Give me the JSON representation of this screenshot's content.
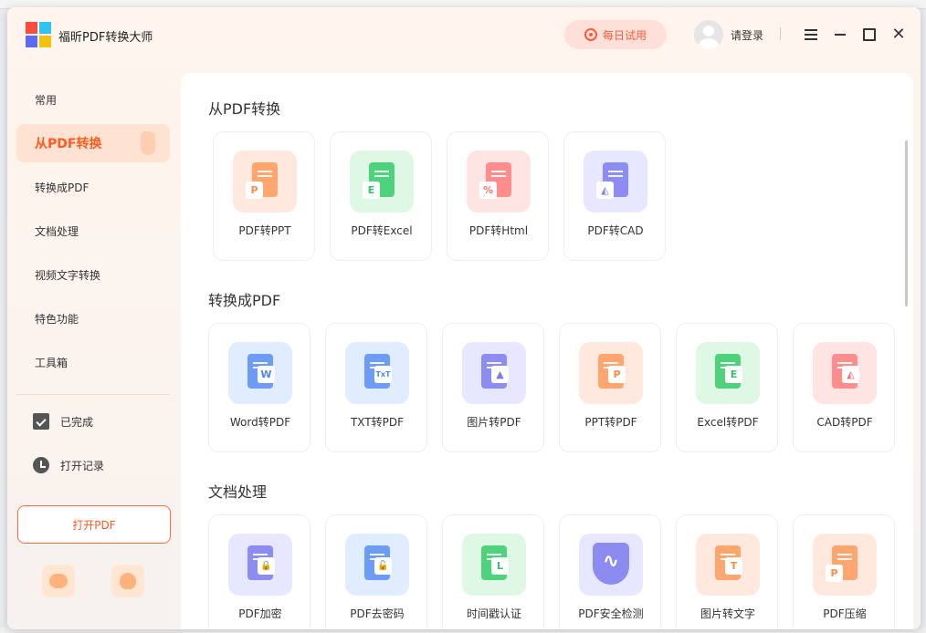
{
  "app": {
    "title": "福昕PDF转换大师",
    "trial_label": "每日试用",
    "login_label": "请登录"
  },
  "sidebar": {
    "items": [
      {
        "label": "常用"
      },
      {
        "label": "从PDF转换",
        "active": true
      },
      {
        "label": "转换成PDF"
      },
      {
        "label": "文档处理"
      },
      {
        "label": "视频文字转换"
      },
      {
        "label": "特色功能"
      },
      {
        "label": "工具箱"
      }
    ],
    "completed_label": "已完成",
    "history_label": "打开记录",
    "open_pdf_label": "打开PDF"
  },
  "sections": [
    {
      "title": "从PDF转换",
      "cards": [
        {
          "label": "PDF转PPT",
          "color": "orange",
          "badge": "P"
        },
        {
          "label": "PDF转Excel",
          "color": "green",
          "badge": "E"
        },
        {
          "label": "PDF转Html",
          "color": "pink",
          "badge": "%"
        },
        {
          "label": "PDF转CAD",
          "color": "purple",
          "badge": "◭"
        }
      ]
    },
    {
      "title": "转换成PDF",
      "cards": [
        {
          "label": "Word转PDF",
          "color": "blue",
          "badge": "W"
        },
        {
          "label": "TXT转PDF",
          "color": "blue",
          "badge": "TxT"
        },
        {
          "label": "图片转PDF",
          "color": "purple",
          "badge": "▲"
        },
        {
          "label": "PPT转PDF",
          "color": "orange",
          "badge": "P"
        },
        {
          "label": "Excel转PDF",
          "color": "green",
          "badge": "E"
        },
        {
          "label": "CAD转PDF",
          "color": "pink",
          "badge": "◭"
        }
      ]
    },
    {
      "title": "文档处理",
      "cards": [
        {
          "label": "PDF加密",
          "color": "purple",
          "badge": "🔒"
        },
        {
          "label": "PDF去密码",
          "color": "blue",
          "badge": "🔓"
        },
        {
          "label": "时间戳认证",
          "color": "green",
          "badge": "L"
        },
        {
          "label": "PDF安全检测",
          "color": "purple",
          "badge": ""
        },
        {
          "label": "图片转文字",
          "color": "orange",
          "badge": "T"
        },
        {
          "label": "PDF压缩",
          "color": "orange",
          "badge": "P"
        }
      ]
    }
  ]
}
